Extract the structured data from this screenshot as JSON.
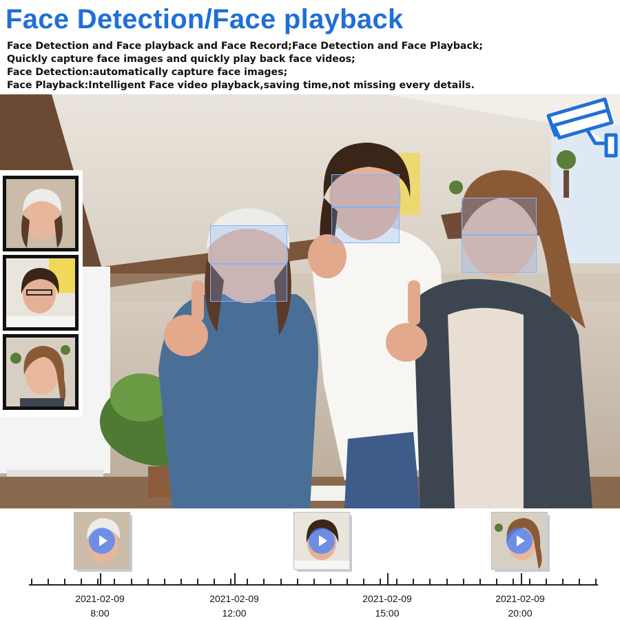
{
  "title": "Face Detection/Face playback",
  "description": [
    "Face Detection and Face playback and Face Record;Face Detection and Face Playback;",
    "Quickly capture face images and quickly play back face videos;",
    "Face Detection:automatically capture face images;",
    "Face Playback:Intelligent Face video playback,saving time,not missing every details."
  ],
  "icons": {
    "camera": "security-camera-icon",
    "play": "play-icon"
  },
  "colors": {
    "title": "#1f6fd6",
    "face_box": "#7fb3ff",
    "camera": "#1f6fd6"
  },
  "timeline": {
    "entries": [
      {
        "date": "2021-02-09",
        "time": "8:00"
      },
      {
        "date": "2021-02-09",
        "time": "12:00"
      },
      {
        "date": "2021-02-09",
        "time": "15:00"
      },
      {
        "date": "2021-02-09",
        "time": "20:00"
      }
    ]
  }
}
